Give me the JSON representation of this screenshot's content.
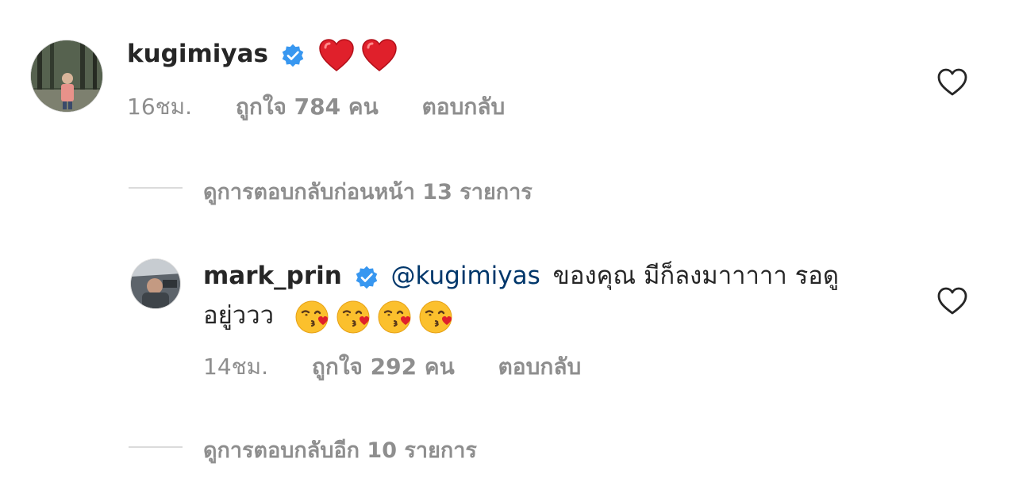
{
  "comments": [
    {
      "username": "kugimiyas",
      "verified": true,
      "text_emoji": "❤️❤️",
      "time": "16ชม.",
      "likes": "ถูกใจ 784 คน",
      "reply": "ตอบกลับ",
      "avatar_icon": "profile-photo-person-in-forest"
    },
    {
      "username": "mark_prin",
      "verified": true,
      "mention": "@kugimiyas",
      "text_line1": "ของคุณ มีก็ลงมาาาาา รอดู",
      "text_line2": "อยู่ววว",
      "emoji_count": 4,
      "emoji_name": "face-blowing-kiss",
      "time": "14ชม.",
      "likes": "ถูกใจ 292 คน",
      "reply": "ตอบกลับ",
      "avatar_icon": "profile-photo-person-in-car"
    }
  ],
  "view_previous": "ดูการตอบกลับก่อนหน้า 13 รายการ",
  "view_more": "ดูการตอบกลับอีก 10 รายการ",
  "colors": {
    "text": "#262626",
    "secondary": "#8e8e8e",
    "mention": "#00376b",
    "verified": "#3897f0",
    "heart_red": "#e0202b"
  }
}
